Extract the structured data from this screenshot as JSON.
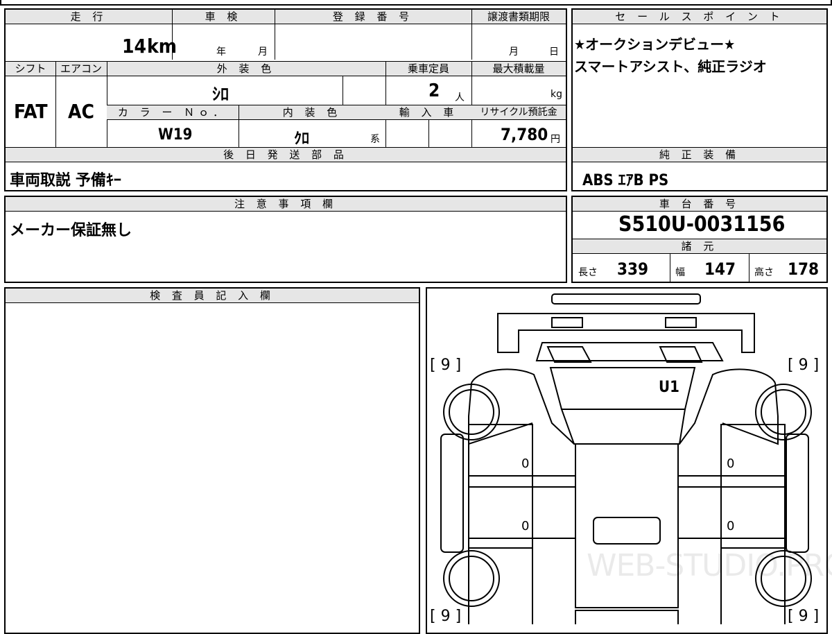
{
  "header": {
    "mileage_label": "走 行",
    "shaken_label": "車 検",
    "registration_label": "登 録 番 号",
    "transfer_deadline_label": "譲渡書類期限",
    "sales_point_label": "セ ー ル ス ポ イ ン ト"
  },
  "vehicle": {
    "mileage_value": "14",
    "mileage_unit": "km",
    "shaken_year_unit": "年",
    "shaken_month_unit": "月",
    "transfer_month_unit": "月",
    "transfer_day_unit": "日",
    "shift_label": "シフト",
    "shift_value": "FAT",
    "aircon_label": "エアコン",
    "aircon_value": "AC",
    "exterior_color_label": "外 装 色",
    "exterior_color_value": "ｼﾛ",
    "capacity_label": "乗車定員",
    "capacity_value": "2",
    "capacity_unit": "人",
    "max_load_label": "最大積載量",
    "max_load_unit": "kg",
    "color_no_label": "カ ラ ー Ｎｏ．",
    "color_no_value": "W19",
    "interior_color_label": "内 装 色",
    "interior_color_value": "ｸﾛ",
    "interior_color_suffix": "系",
    "import_label": "輸 入 車",
    "recycle_label": "リサイクル預託金",
    "recycle_value": "7,780",
    "recycle_unit": "円"
  },
  "sales_points": {
    "line1": "★オークションデビュー★",
    "line2": "スマートアシスト、純正ラジオ"
  },
  "later_parts": {
    "label": "後 日 発 送 部 品",
    "value": "車両取説 予備ｷｰ"
  },
  "genuine_equipment": {
    "label": "純 正 装 備",
    "value": "ABS ｴｱB PS"
  },
  "notes": {
    "label": "注 意 事 項 欄",
    "value": "メーカー保証無し"
  },
  "chassis": {
    "label": "車 台 番 号",
    "value": "S510U-0031156",
    "specs_label": "諸 元",
    "length_label": "長さ",
    "length_value": "339",
    "width_label": "幅",
    "width_value": "147",
    "height_label": "高さ",
    "height_value": "178"
  },
  "inspector": {
    "label": "検 査 員 記 入 欄"
  },
  "diagram": {
    "tire_fl": "[ 9 ]",
    "tire_fr": "[ 9 ]",
    "tire_rl": "[ 9 ]",
    "tire_rr": "[ 9 ]",
    "mark_u1": "U1",
    "mark_0": "0",
    "watermark": "WEB-STUDIO.PRO"
  }
}
